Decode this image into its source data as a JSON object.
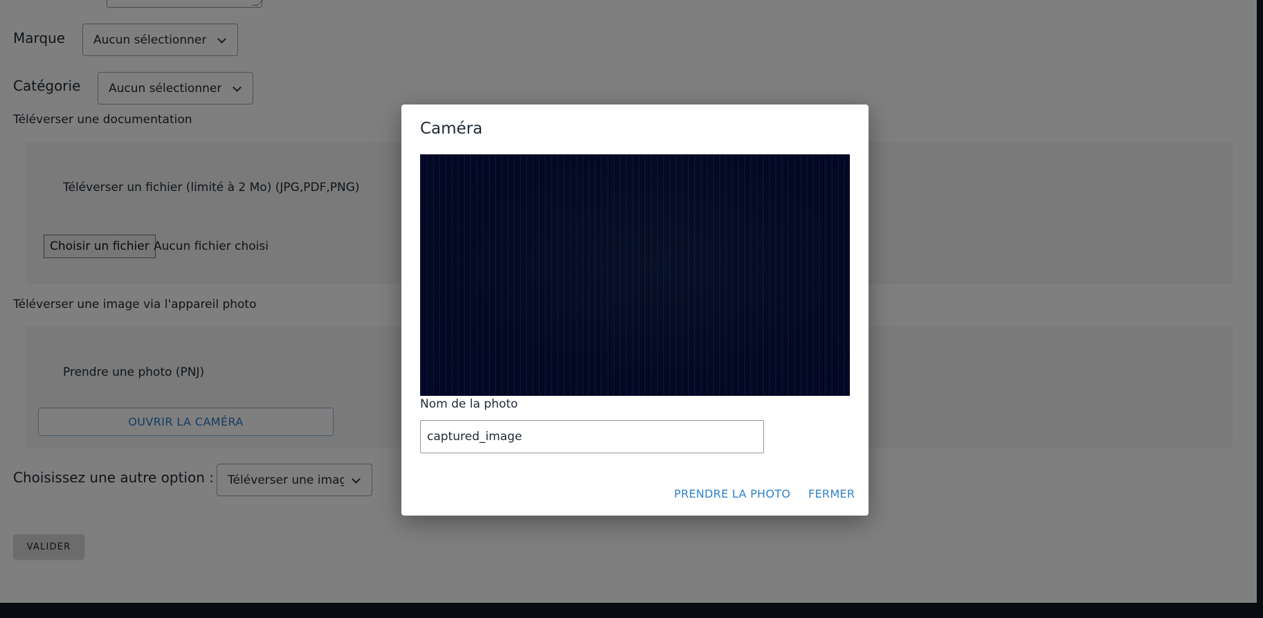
{
  "form": {
    "brand": {
      "label": "Marque",
      "selected": "Aucun sélectionner"
    },
    "category": {
      "label": "Catégorie",
      "selected": "Aucun sélectionner"
    },
    "documentation": {
      "title": "Téléverser une documentation",
      "file_instruction": "Téléverser un fichier (limité à 2 Mo) (JPG,PDF,PNG)",
      "choose_file_label": "Choisir un fichier",
      "file_status": "Aucun fichier choisi"
    },
    "camera_upload": {
      "title": "Téléverser une image via l'appareil photo",
      "instruction": "Prendre une photo (PNJ)",
      "open_camera_label": "OUVRIR LA CAMÉRA"
    },
    "other_option": {
      "label": "Choisissez une autre option :",
      "selected": "Téléverser une image"
    },
    "submit_label": "VALIDER"
  },
  "camera_modal": {
    "title": "Caméra",
    "photo_name_label": "Nom de la photo",
    "photo_name_value": "captured_image",
    "take_photo_label": "PRENDRE LA PHOTO",
    "close_label": "FERMER"
  }
}
